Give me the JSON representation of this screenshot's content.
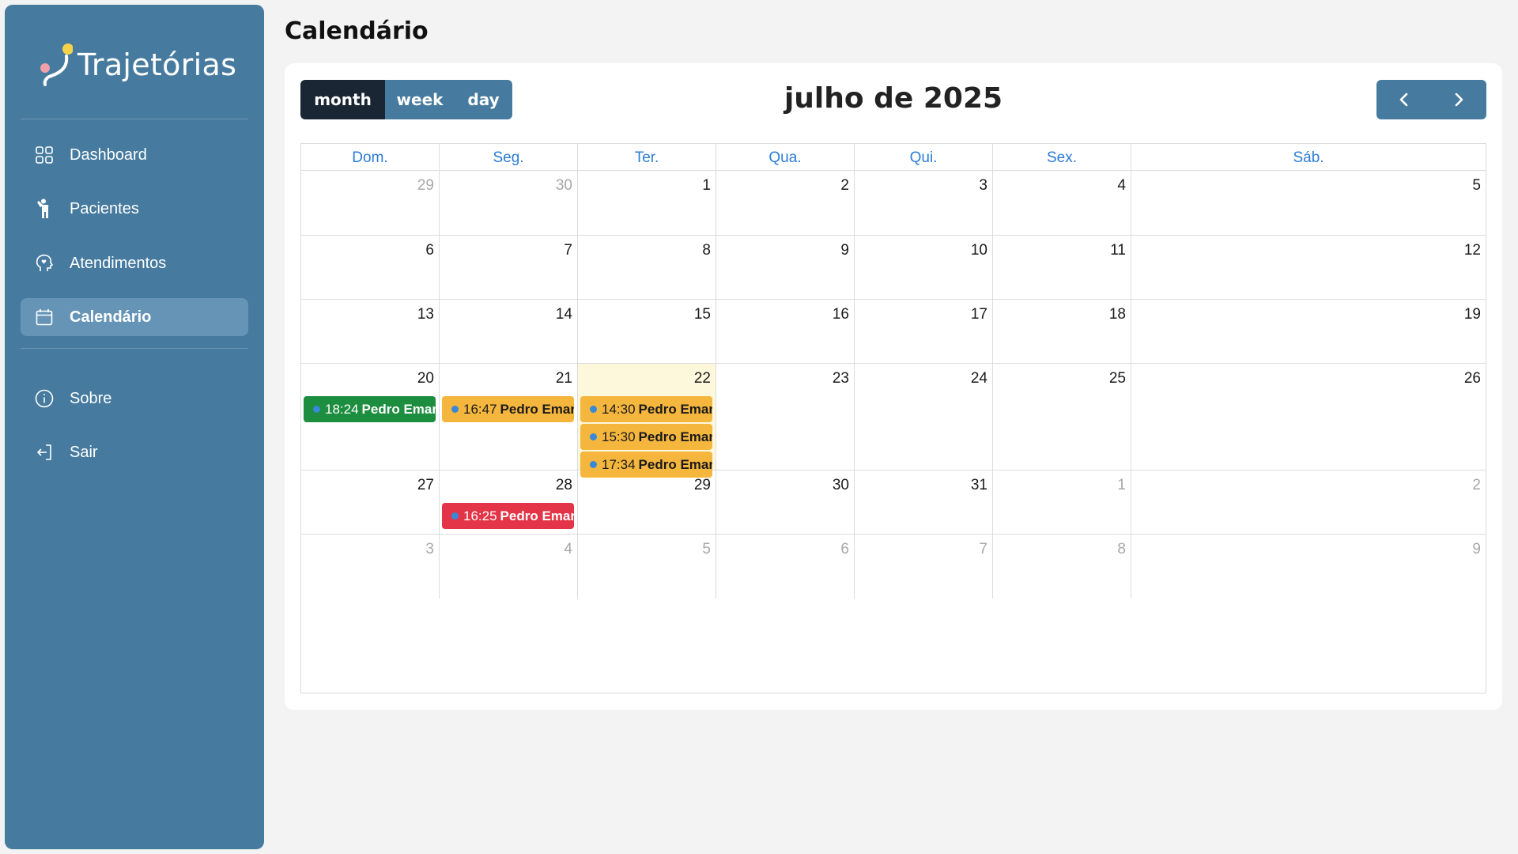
{
  "app": {
    "name": "Trajetórias"
  },
  "sidebar": {
    "items": [
      {
        "label": "Dashboard",
        "icon": "grid-icon"
      },
      {
        "label": "Pacientes",
        "icon": "person-icon"
      },
      {
        "label": "Atendimentos",
        "icon": "head-heart-icon"
      },
      {
        "label": "Calendário",
        "icon": "calendar-icon",
        "active": true
      }
    ],
    "bottom_items": [
      {
        "label": "Sobre",
        "icon": "info-icon"
      },
      {
        "label": "Sair",
        "icon": "logout-icon"
      }
    ]
  },
  "page": {
    "title": "Calendário"
  },
  "calendar": {
    "views": [
      "month",
      "week",
      "day"
    ],
    "active_view": "month",
    "title": "julho de 2025",
    "weekdays": [
      "Dom.",
      "Seg.",
      "Ter.",
      "Qua.",
      "Qui.",
      "Sex.",
      "Sáb."
    ],
    "weeks": [
      [
        "29",
        "30",
        "1",
        "2",
        "3",
        "4",
        "5"
      ],
      [
        "6",
        "7",
        "8",
        "9",
        "10",
        "11",
        "12"
      ],
      [
        "13",
        "14",
        "15",
        "16",
        "17",
        "18",
        "19"
      ],
      [
        "20",
        "21",
        "22",
        "23",
        "24",
        "25",
        "26"
      ],
      [
        "27",
        "28",
        "29",
        "30",
        "31",
        "1",
        "2"
      ],
      [
        "3",
        "4",
        "5",
        "6",
        "7",
        "8",
        "9"
      ]
    ],
    "today": "22",
    "events": [
      {
        "day": "20",
        "time": "18:24",
        "name": "Pedro Emanuel",
        "color": "#1d8d3f"
      },
      {
        "day": "21",
        "time": "16:47",
        "name": "Pedro Emanuel",
        "color": "#f5b63e"
      },
      {
        "day": "22",
        "time": "14:30",
        "name": "Pedro Emanuel",
        "color": "#f5b63e"
      },
      {
        "day": "22",
        "time": "15:30",
        "name": "Pedro Emanuel",
        "color": "#f5b63e"
      },
      {
        "day": "22",
        "time": "17:34",
        "name": "Pedro Emanuel",
        "color": "#f5b63e"
      },
      {
        "day": "28",
        "time": "16:25",
        "name": "Pedro Emanuel",
        "color": "#e33547"
      }
    ]
  },
  "colors": {
    "sidebar": "#467b9f",
    "active_item": "#6594b6",
    "accent": "#2b7cd6",
    "today": "#fdf7dc"
  }
}
